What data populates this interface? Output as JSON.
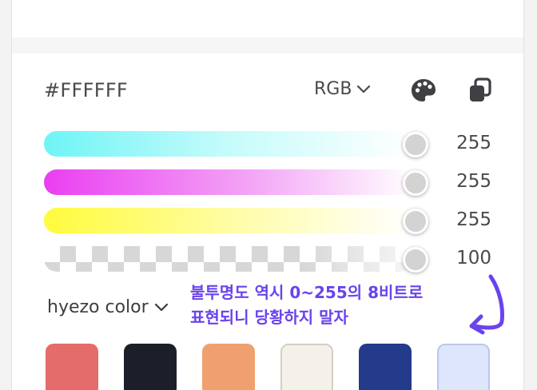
{
  "color": {
    "hex": "#FFFFFF",
    "mode": "RGB"
  },
  "sliders": [
    {
      "channel": "red",
      "value": "255",
      "fraction": 1.0
    },
    {
      "channel": "green",
      "value": "255",
      "fraction": 1.0
    },
    {
      "channel": "blue",
      "value": "255",
      "fraction": 1.0
    },
    {
      "channel": "alpha",
      "value": "100",
      "fraction": 1.0
    }
  ],
  "palette": {
    "name": "hyezo color",
    "swatches": [
      "#e46c6a",
      "#1c1f2a",
      "#f0a06f",
      "#f4f1ea",
      "#243a8a",
      "#dde6fb"
    ]
  },
  "annotation": {
    "line1": "불투명도 역시 0~255의 8비트로",
    "line2": "표현되니 당황하지 말자",
    "color": "#6a43ee"
  },
  "icons": [
    "palette-icon",
    "copy-icon",
    "chevron-down-icon"
  ]
}
